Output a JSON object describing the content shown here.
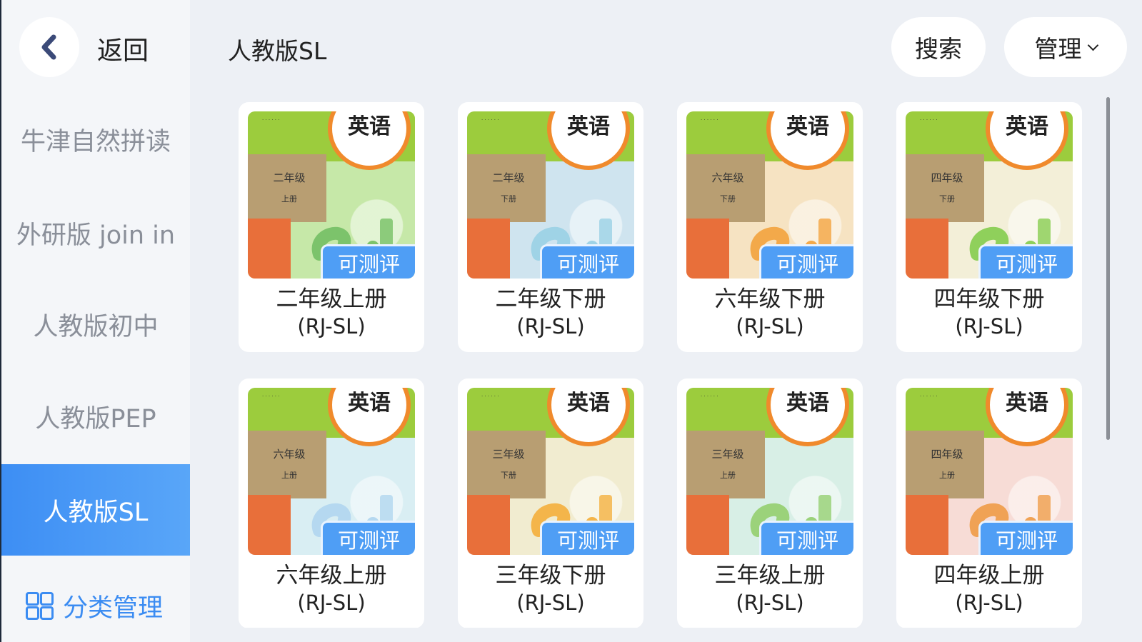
{
  "sidebar": {
    "back_label": "返回",
    "items": [
      {
        "label": "牛津自然拼读",
        "active": false
      },
      {
        "label": "外研版 join in",
        "active": false
      },
      {
        "label": "人教版初中",
        "active": false
      },
      {
        "label": "人教版PEP",
        "active": false
      },
      {
        "label": "人教版SL",
        "active": true
      }
    ],
    "category_manage_label": "分类管理"
  },
  "header": {
    "title": "人教版SL",
    "search_label": "搜索",
    "manage_label": "管理"
  },
  "books": [
    {
      "name": "二年级上册",
      "code": "(RJ-SL)",
      "badge": "可测评",
      "cover_title": "英语",
      "cover_grade": "二年级",
      "cover_volume": "上册",
      "cover_color": "#c6e8a8"
    },
    {
      "name": "二年级下册",
      "code": "(RJ-SL)",
      "badge": "可测评",
      "cover_title": "英语",
      "cover_grade": "二年级",
      "cover_volume": "下册",
      "cover_color": "#cfe4ef"
    },
    {
      "name": "六年级下册",
      "code": "(RJ-SL)",
      "badge": "可测评",
      "cover_title": "英语",
      "cover_grade": "六年级",
      "cover_volume": "下册",
      "cover_color": "#f6e3c2"
    },
    {
      "name": "四年级下册",
      "code": "(RJ-SL)",
      "badge": "可测评",
      "cover_title": "英语",
      "cover_grade": "四年级",
      "cover_volume": "下册",
      "cover_color": "#f3efd8"
    },
    {
      "name": "六年级上册",
      "code": "(RJ-SL)",
      "badge": "可测评",
      "cover_title": "英语",
      "cover_grade": "六年级",
      "cover_volume": "上册",
      "cover_color": "#d9eef3"
    },
    {
      "name": "三年级下册",
      "code": "(RJ-SL)",
      "badge": "可测评",
      "cover_title": "英语",
      "cover_grade": "三年级",
      "cover_volume": "下册",
      "cover_color": "#f1ecd0"
    },
    {
      "name": "三年级上册",
      "code": "(RJ-SL)",
      "badge": "可测评",
      "cover_title": "英语",
      "cover_grade": "三年级",
      "cover_volume": "上册",
      "cover_color": "#d8efe6"
    },
    {
      "name": "四年级上册",
      "code": "(RJ-SL)",
      "badge": "可测评",
      "cover_title": "英语",
      "cover_grade": "四年级",
      "cover_volume": "上册",
      "cover_color": "#f7dcd6"
    }
  ],
  "colors": {
    "accent": "#3d8ef4",
    "badge": "#4f9ef5",
    "background": "#edf0f5"
  }
}
